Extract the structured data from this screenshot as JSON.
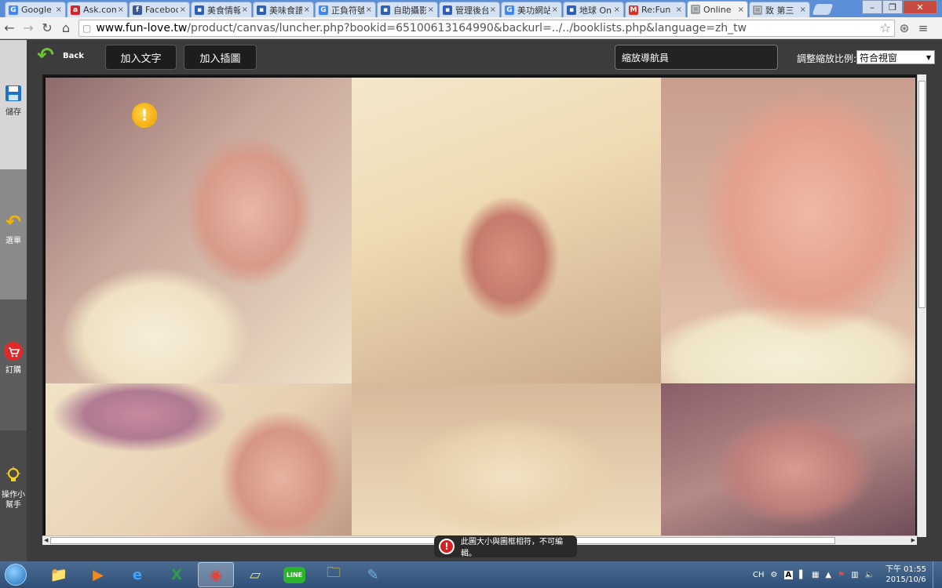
{
  "browser": {
    "tabs": [
      {
        "label": "Google",
        "favicon": "G",
        "favicon_color": "#4285f4",
        "active": false
      },
      {
        "label": "Ask.com",
        "favicon": "a",
        "favicon_color": "#d4242a",
        "active": false
      },
      {
        "label": "Facebook",
        "favicon": "f",
        "favicon_color": "#3b5998",
        "active": false
      },
      {
        "label": "美食情報",
        "favicon": "▪",
        "favicon_color": "#2d5fb8",
        "active": false
      },
      {
        "label": "美味食譜",
        "favicon": "▪",
        "favicon_color": "#2d5fb8",
        "active": false
      },
      {
        "label": "正負符號",
        "favicon": "G",
        "favicon_color": "#4285f4",
        "active": false
      },
      {
        "label": "自助攝影",
        "favicon": "▪",
        "favicon_color": "#2d5fb8",
        "active": false
      },
      {
        "label": "管理後台",
        "favicon": "▪",
        "favicon_color": "#2d5fb8",
        "active": false
      },
      {
        "label": "美功網站",
        "favicon": "G",
        "favicon_color": "#4285f4",
        "active": false
      },
      {
        "label": "地球 Online",
        "favicon": "▪",
        "favicon_color": "#2d5fb8",
        "active": false
      },
      {
        "label": "Re:Fun",
        "favicon": "M",
        "favicon_color": "#d93025",
        "active": false
      },
      {
        "label": "Online",
        "favicon": "□",
        "favicon_color": "#9aa0a6",
        "active": true
      },
      {
        "label": "致 第三",
        "favicon": "□",
        "favicon_color": "#9aa0a6",
        "active": false
      }
    ],
    "url_host": "www.fun-love.tw",
    "url_rest": "/product/canvas/luncher.php?bookid=65100613164990&backurl=../../booklists.php&language=zh_tw"
  },
  "sidebar": {
    "items": [
      {
        "label": "儲存",
        "icon": "save-icon"
      },
      {
        "label": "選單",
        "icon": "undo-icon"
      },
      {
        "label": "訂購",
        "icon": "cart-icon"
      },
      {
        "label": "操作小幫手",
        "icon": "lightbulb-icon"
      }
    ]
  },
  "editor": {
    "back_label": "Back",
    "add_text_label": "加入文字",
    "add_illustration_label": "加入插圖",
    "navigator_label": "縮放導航員",
    "zoom_label": "調整縮放比例:",
    "zoom_value": "符合視窗",
    "warning_badge": "!"
  },
  "toast": {
    "icon": "!",
    "message": "此圖大小與圖框相符，不可編輯。"
  },
  "taskbar": {
    "language": "CH",
    "time": "下午 01:55",
    "date": "2015/10/6",
    "apps": [
      "explorer-folder-icon",
      "media-player-icon",
      "internet-explorer-icon",
      "excel-icon",
      "chrome-icon",
      "notes-icon",
      "line-icon",
      "file-manager-icon",
      "paint-icon"
    ],
    "line_label": "LINE",
    "tray_a": "A"
  }
}
